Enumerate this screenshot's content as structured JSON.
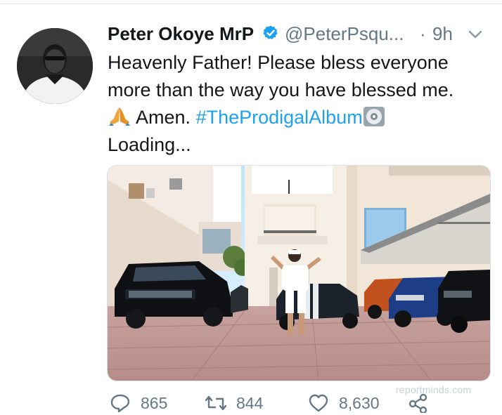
{
  "tweet": {
    "display_name": "Peter Okoye MrP",
    "handle": "@PeterPsqu...",
    "separator": "·",
    "time": "9h",
    "lines": [
      "Heavenly Father! Please bless everyone",
      "more than the way you have blessed me."
    ],
    "amen": "Amen.",
    "hashtag": "#TheProdigalAlbum",
    "loading": "Loading..."
  },
  "stats": {
    "replies": "865",
    "retweets": "844",
    "likes": "8,630"
  },
  "watermark": "reportminds.com",
  "colors": {
    "link": "#1da1f2",
    "verified": "#1da1f2",
    "secondary_text": "#657786",
    "divider": "#e1e8ed"
  },
  "icons": {
    "verified": "verified-badge-icon",
    "caret": "chevron-down-icon",
    "emoji_1": "folded-hands-emoji",
    "emoji_2": "cd-disc-emoji",
    "reply": "reply-icon",
    "retweet": "retweet-icon",
    "like": "heart-icon",
    "share": "share-icon"
  }
}
